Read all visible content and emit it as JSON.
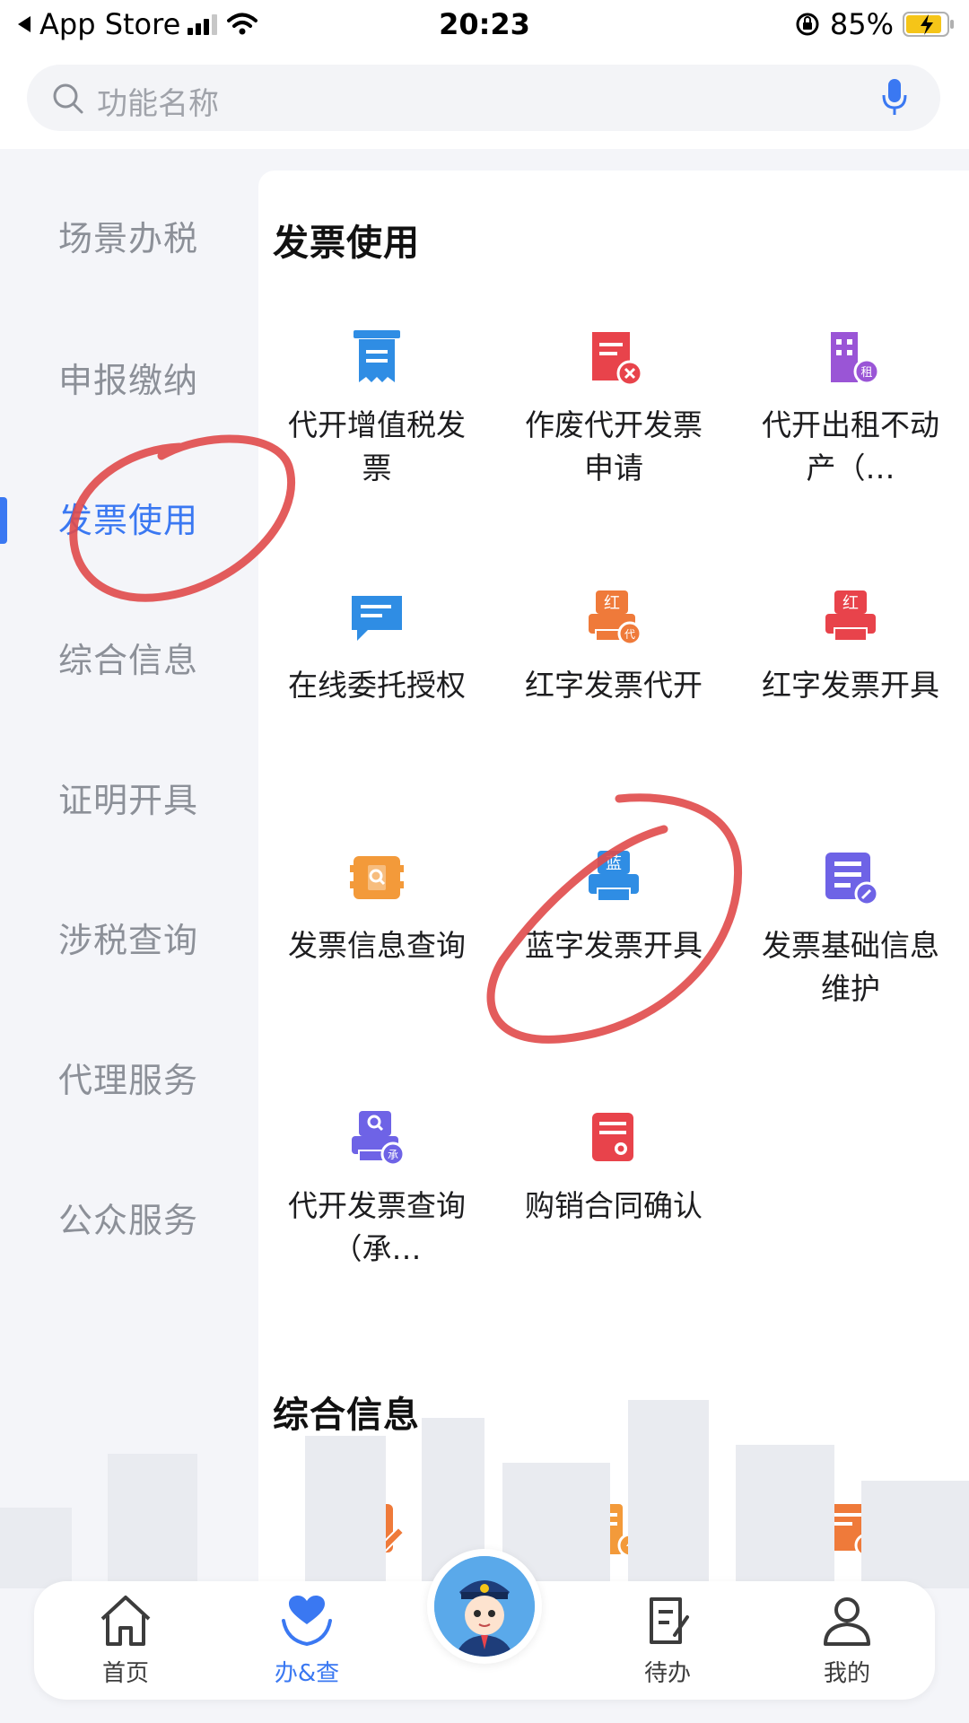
{
  "status_bar": {
    "back_app": "App Store",
    "time": "20:23",
    "battery": "85%"
  },
  "search": {
    "placeholder": "功能名称"
  },
  "sidebar": {
    "items": [
      {
        "label": "场景办税"
      },
      {
        "label": "申报缴纳"
      },
      {
        "label": "发票使用",
        "active": true
      },
      {
        "label": "综合信息"
      },
      {
        "label": "证明开具"
      },
      {
        "label": "涉税查询"
      },
      {
        "label": "代理服务"
      },
      {
        "label": "公众服务"
      }
    ]
  },
  "sections": [
    {
      "title": "发票使用",
      "tiles": [
        {
          "label": "代开增值税发票",
          "icon": "receipt-icon",
          "color": "#2f8de4"
        },
        {
          "label": "作废代开发票申请",
          "icon": "void-invoice-icon",
          "color": "#e8434b"
        },
        {
          "label": "代开出租不动产（…",
          "icon": "rental-building-icon",
          "color": "#9a55d6"
        },
        {
          "label": "在线委托授权",
          "icon": "chat-authorize-icon",
          "color": "#2f8de4"
        },
        {
          "label": "红字发票代开",
          "icon": "red-invoice-agent-icon",
          "color": "#ef7a3a",
          "badge": "红",
          "sub": "代"
        },
        {
          "label": "红字发票开具",
          "icon": "red-invoice-printer-icon",
          "color": "#e8434b",
          "badge": "红"
        },
        {
          "label": "发票信息查询",
          "icon": "invoice-search-icon",
          "color": "#f39a3a"
        },
        {
          "label": "蓝字发票开具",
          "icon": "blue-invoice-printer-icon",
          "color": "#2f8de4",
          "badge": "蓝"
        },
        {
          "label": "发票基础信息维护",
          "icon": "invoice-maintain-icon",
          "color": "#6e63e6"
        },
        {
          "label": "代开发票查询（承…",
          "icon": "agent-invoice-query-icon",
          "color": "#6e63e6",
          "sub": "承"
        },
        {
          "label": "购销合同确认",
          "icon": "contract-confirm-icon",
          "color": "#e8434b"
        }
      ]
    },
    {
      "title": "综合信息",
      "tiles": [
        {
          "icon": "edit-document-icon",
          "color": "#ef7a3a"
        },
        {
          "icon": "building-bolt-icon",
          "color": "#f39a3a"
        },
        {
          "icon": "document-export-icon",
          "color": "#ef7a3a"
        }
      ]
    }
  ],
  "bottom_nav": {
    "items": [
      {
        "label": "首页",
        "icon": "home-icon"
      },
      {
        "label": "办&查",
        "icon": "heart-hands-icon",
        "active": true
      },
      {
        "label": "待办",
        "icon": "todo-icon"
      },
      {
        "label": "我的",
        "icon": "user-icon"
      }
    ],
    "center": {
      "icon": "tax-officer-avatar-icon"
    }
  },
  "colors": {
    "accent": "#3a78f2",
    "annotation": "#e04a4a"
  }
}
